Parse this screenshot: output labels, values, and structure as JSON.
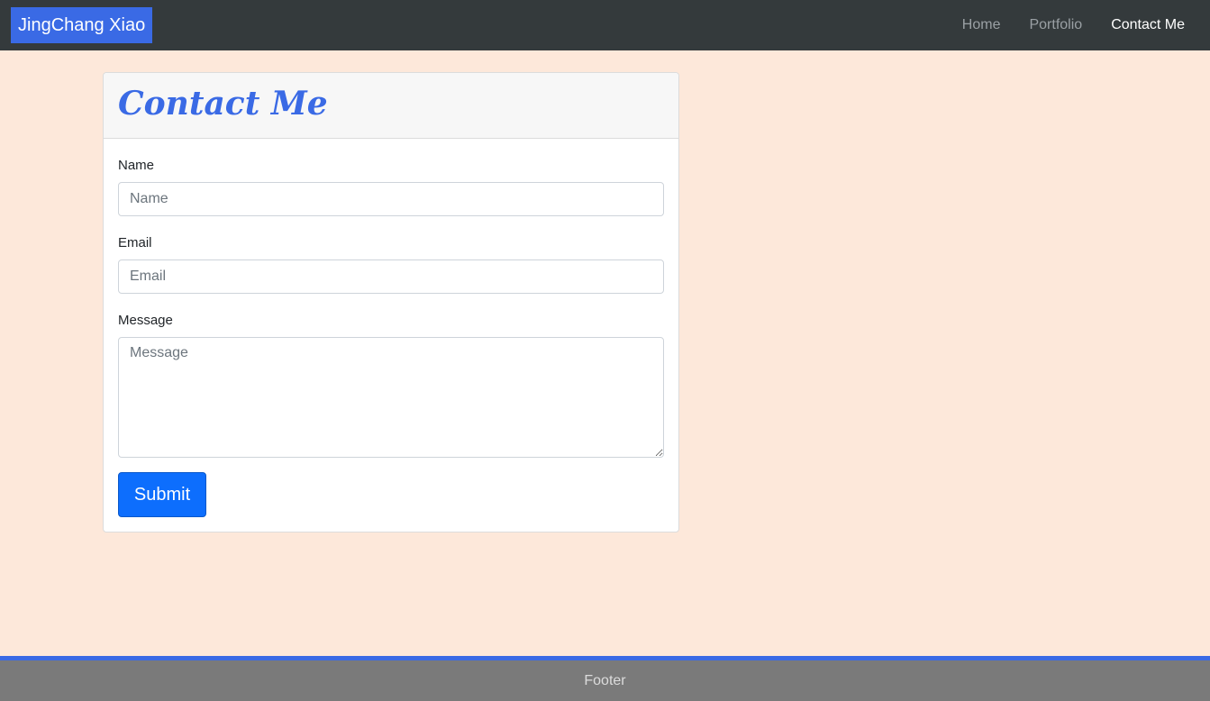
{
  "navbar": {
    "brand": "JingChang Xiao",
    "links": [
      {
        "label": "Home"
      },
      {
        "label": "Portfolio"
      },
      {
        "label": "Contact Me"
      }
    ]
  },
  "card": {
    "title": "Contact Me",
    "form": {
      "name_label": "Name",
      "name_placeholder": "Name",
      "email_label": "Email",
      "email_placeholder": "Email",
      "message_label": "Message",
      "message_placeholder": "Message",
      "submit_label": "Submit"
    }
  },
  "footer": {
    "text": "Footer"
  },
  "colors": {
    "accent": "#3a6ae5",
    "navbar_bg": "#343a3c",
    "page_bg": "#fde8da",
    "button": "#0d6efd",
    "footer_bg": "#7a7a7a"
  }
}
